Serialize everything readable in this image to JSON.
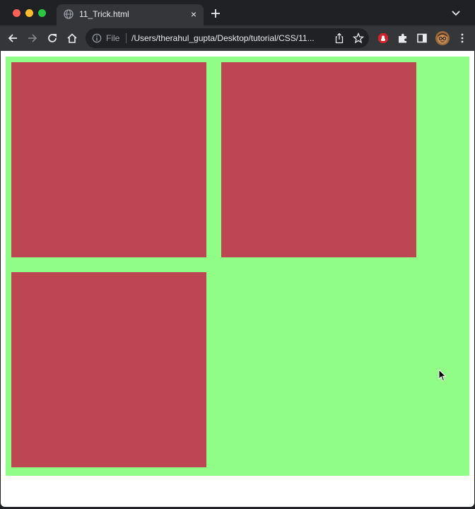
{
  "tab": {
    "title": "11_Trick.html",
    "close": "×"
  },
  "omnibox": {
    "file_label": "File",
    "url": "/Users/therahul_gupta/Desktop/tutorial/CSS/11..."
  },
  "page": {
    "container_color": "#90fd87",
    "box_color": "#bc4652",
    "boxes": [
      "box-1",
      "box-2",
      "box-3"
    ]
  },
  "icons": {
    "tab": [
      "globe-icon",
      "close-icon",
      "plus-icon",
      "chevron-down-icon"
    ],
    "toolbar": [
      "back-arrow-icon",
      "forward-arrow-icon",
      "reload-icon",
      "home-icon",
      "info-icon",
      "share-icon",
      "star-icon",
      "stop-sign-extension-icon",
      "puzzle-icon",
      "sidebar-icon",
      "avatar",
      "kebab-menu-icon"
    ]
  }
}
